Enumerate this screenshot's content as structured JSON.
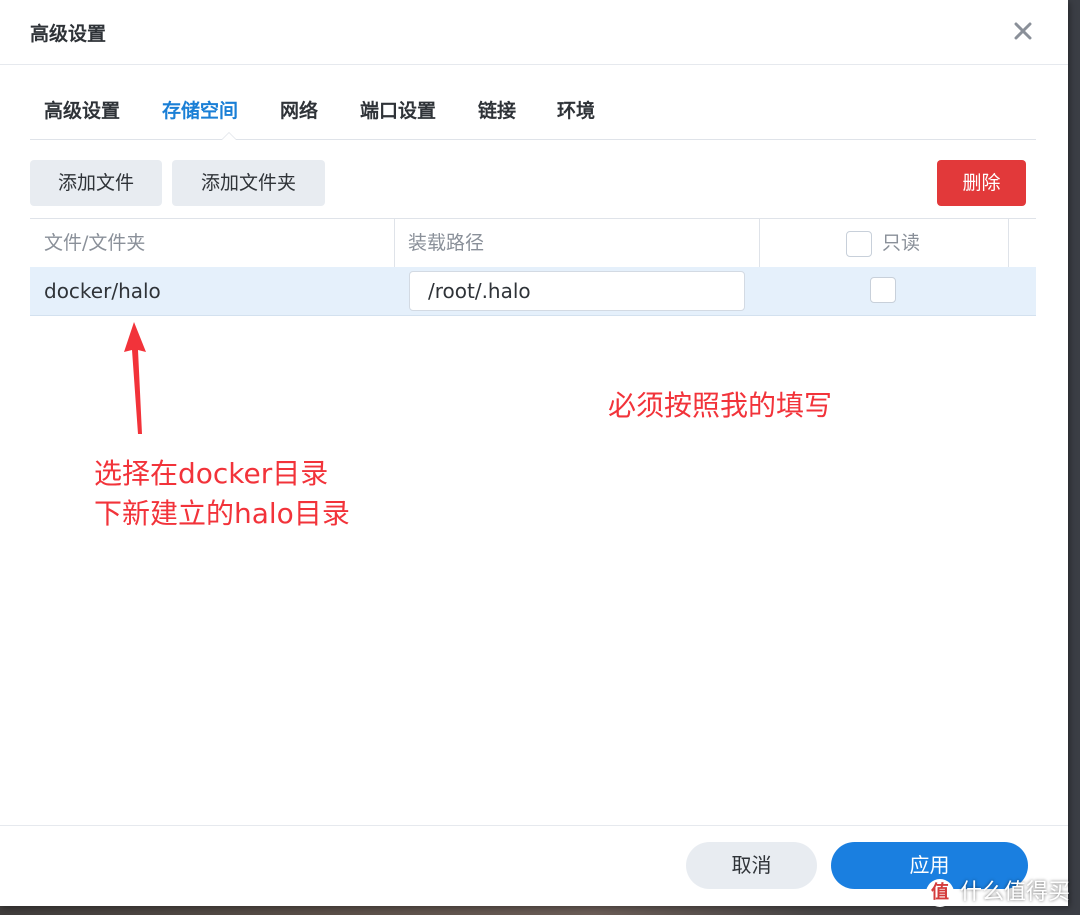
{
  "dialog": {
    "title": "高级设置"
  },
  "tabs": [
    {
      "label": "高级设置",
      "active": false
    },
    {
      "label": "存储空间",
      "active": true
    },
    {
      "label": "网络",
      "active": false
    },
    {
      "label": "端口设置",
      "active": false
    },
    {
      "label": "链接",
      "active": false
    },
    {
      "label": "环境",
      "active": false
    }
  ],
  "toolbar": {
    "add_file_label": "添加文件",
    "add_folder_label": "添加文件夹",
    "delete_label": "删除"
  },
  "table": {
    "headers": {
      "file_folder": "文件/文件夹",
      "mount_path": "装载路径",
      "read_only": "只读"
    },
    "rows": [
      {
        "file_folder": "docker/halo",
        "mount_path": "/root/.halo",
        "read_only": false
      }
    ]
  },
  "annotations": {
    "select_line1": "选择在docker目录",
    "select_line2": "下新建立的halo目录",
    "must_fill": "必须按照我的填写"
  },
  "footer": {
    "cancel_label": "取消",
    "apply_label": "应用"
  },
  "watermark": {
    "icon": "值",
    "text": "什么值得买"
  },
  "colors": {
    "accent": "#1a7fe0",
    "danger": "#e2393a",
    "annotation": "#f2333a",
    "selected_row": "#e5f0fb"
  }
}
